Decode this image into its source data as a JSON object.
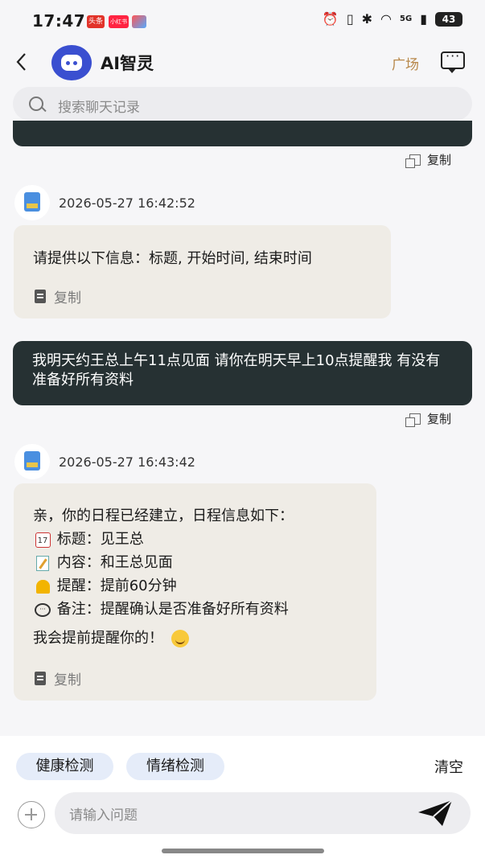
{
  "status_bar": {
    "time": "17:47",
    "badge1": "头条",
    "badge2": "小红书",
    "network": "5G",
    "battery": "43"
  },
  "header": {
    "title": "AI智灵",
    "square_link": "广场"
  },
  "search": {
    "placeholder": "搜索聊天记录"
  },
  "messages": {
    "copy_label": "复制",
    "bot1": {
      "timestamp": "2026-05-27 16:42:52",
      "text": "请提供以下信息：标题, 开始时间, 结束时间"
    },
    "user1": {
      "text": "我明天约王总上午11点见面 请你在明天早上10点提醒我 有没有准备好所有资料"
    },
    "bot2": {
      "timestamp": "2026-05-27 16:43:42",
      "intro": "亲，你的日程已经建立，日程信息如下：",
      "lines": [
        {
          "icon": "calendar-icon",
          "icon_text": "17",
          "text": "标题：见王总"
        },
        {
          "icon": "memo-icon",
          "text": "内容：和王总见面"
        },
        {
          "icon": "bell-icon",
          "text": "提醒：提前60分钟"
        },
        {
          "icon": "speech-bubble-icon",
          "text": "备注：提醒确认是否准备好所有资料"
        }
      ],
      "closing": "我会提前提醒你的！"
    }
  },
  "bottom": {
    "chips": [
      "健康检测",
      "情绪检测"
    ],
    "clear_label": "清空",
    "input_placeholder": "请输入问题"
  },
  "colors": {
    "dark_bubble": "#263133",
    "bot_bubble": "#efece6",
    "accent_link": "#b8884a",
    "chip_bg": "#e5ecf9"
  }
}
